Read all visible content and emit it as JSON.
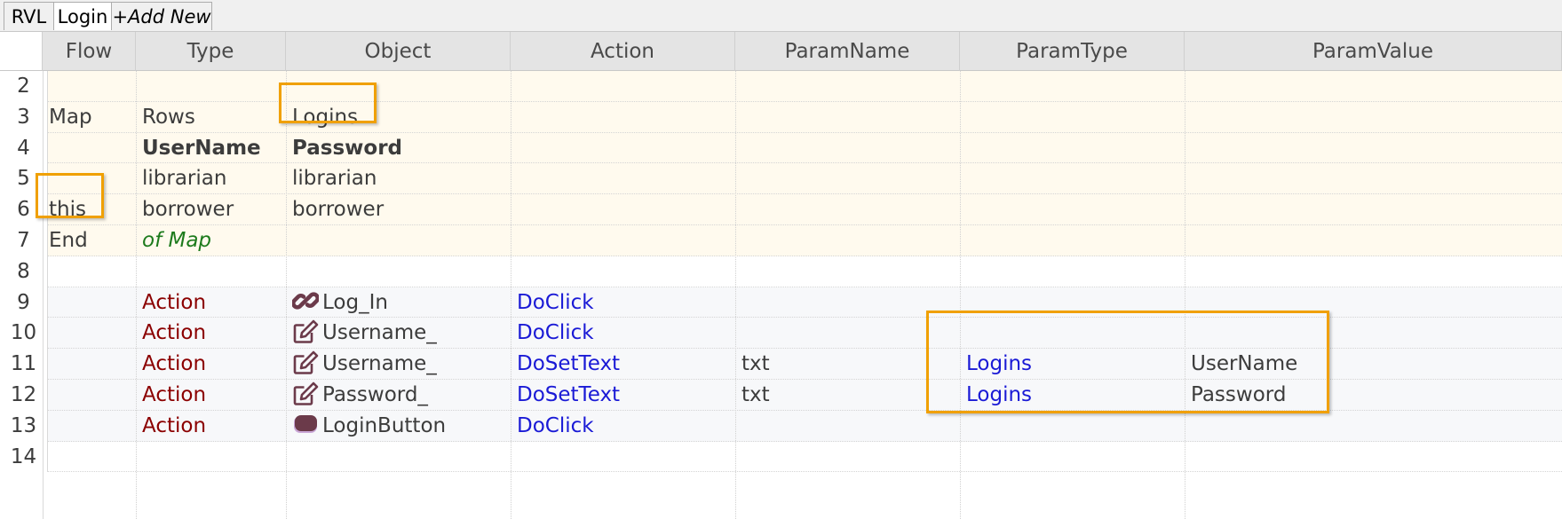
{
  "tabs": [
    {
      "label": "RVL"
    },
    {
      "label": "Login"
    },
    {
      "label": "+Add New"
    }
  ],
  "columns": [
    "Flow",
    "Type",
    "Object",
    "Action",
    "ParamName",
    "ParamType",
    "ParamValue"
  ],
  "rows": [
    {
      "num": "2",
      "flow": "",
      "type": "",
      "object": "",
      "action": "",
      "param_name": "",
      "param_type": "",
      "param_value": ""
    },
    {
      "num": "3",
      "flow": "Map",
      "type": "Rows",
      "object": "Logins",
      "action": "",
      "param_name": "",
      "param_type": "",
      "param_value": ""
    },
    {
      "num": "4",
      "flow": "",
      "type": "UserName",
      "object": "Password",
      "action": "",
      "param_name": "",
      "param_type": "",
      "param_value": ""
    },
    {
      "num": "5",
      "flow": "",
      "type": "librarian",
      "object": "librarian",
      "action": "",
      "param_name": "",
      "param_type": "",
      "param_value": ""
    },
    {
      "num": "6",
      "flow": "this",
      "type": "borrower",
      "object": "borrower",
      "action": "",
      "param_name": "",
      "param_type": "",
      "param_value": ""
    },
    {
      "num": "7",
      "flow": "End",
      "type": "of Map",
      "object": "",
      "action": "",
      "param_name": "",
      "param_type": "",
      "param_value": ""
    },
    {
      "num": "8",
      "flow": "",
      "type": "",
      "object": "",
      "action": "",
      "param_name": "",
      "param_type": "",
      "param_value": ""
    },
    {
      "num": "9",
      "flow": "",
      "type": "Action",
      "object": "Log_In",
      "object_icon": "link-icon",
      "action": "DoClick",
      "param_name": "",
      "param_type": "",
      "param_value": ""
    },
    {
      "num": "10",
      "flow": "",
      "type": "Action",
      "object": "Username_",
      "object_icon": "edit-icon",
      "action": "DoClick",
      "param_name": "",
      "param_type": "",
      "param_value": ""
    },
    {
      "num": "11",
      "flow": "",
      "type": "Action",
      "object": "Username_",
      "object_icon": "edit-icon",
      "action": "DoSetText",
      "param_name": "txt",
      "param_type": "Logins",
      "param_value": "UserName"
    },
    {
      "num": "12",
      "flow": "",
      "type": "Action",
      "object": "Password_",
      "object_icon": "edit-icon",
      "action": "DoSetText",
      "param_name": "txt",
      "param_type": "Logins",
      "param_value": "Password"
    },
    {
      "num": "13",
      "flow": "",
      "type": "Action",
      "object": "LoginButton",
      "object_icon": "button-icon",
      "action": "DoClick",
      "param_name": "",
      "param_type": "",
      "param_value": ""
    },
    {
      "num": "14",
      "flow": "",
      "type": "",
      "object": "",
      "action": "",
      "param_name": "",
      "param_type": "",
      "param_value": ""
    }
  ],
  "colors": {
    "map_block_bg": "#fffaee",
    "action_block_bg": "#f7f8fa",
    "type_action": "#8b0000",
    "action_text": "#1a1ad6",
    "of_map_text": "#1c7a1c",
    "highlight": "#f0a000"
  }
}
